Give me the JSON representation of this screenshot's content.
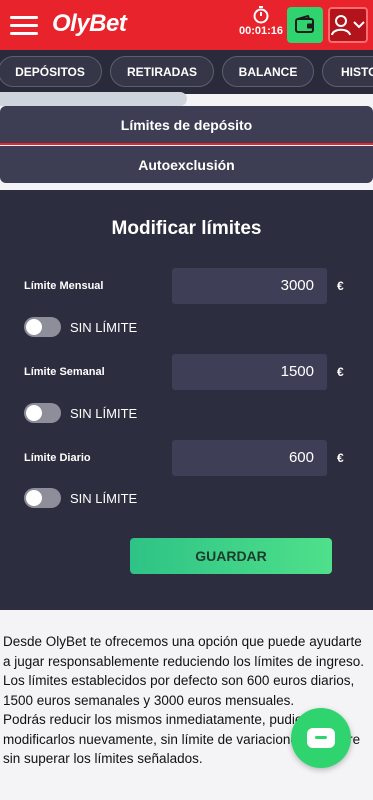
{
  "header": {
    "brand": "OlyBet",
    "session_time": "00:01:16"
  },
  "tabs": [
    {
      "label": "DEPÓSITOS"
    },
    {
      "label": "RETIRADAS"
    },
    {
      "label": "BALANCE"
    },
    {
      "label": "HISTO"
    }
  ],
  "submenu": {
    "deposit_limits": "Límites de depósito",
    "self_exclusion": "Autoexclusión"
  },
  "form": {
    "title": "Modificar límites",
    "currency": "€",
    "monthly": {
      "label": "Límite Mensual",
      "value": "3000",
      "toggle_label": "SIN LÍMITE",
      "unlimited": false
    },
    "weekly": {
      "label": "Límite Semanal",
      "value": "1500",
      "toggle_label": "SIN LÍMITE",
      "unlimited": false
    },
    "daily": {
      "label": "Límite Diario",
      "value": "600",
      "toggle_label": "SIN LÍMITE",
      "unlimited": false
    },
    "save_label": "GUARDAR"
  },
  "info": {
    "text": "Desde OlyBet te ofrecemos una opción que puede ayudarte a jugar responsablemente reduciendo los límites de ingreso.\nLos límites establecidos por defecto son 600 euros diarios, 1500 euros semanales y 3000 euros mensuales.\nPodrás reducir los mismos inmediatamente, pudiendo modificarlos nuevamente, sin límite de variaciones, siempre sin superar los límites señalados."
  },
  "colors": {
    "brand_red": "#e8232b",
    "accent_green": "#2fd46e",
    "panel_dark": "#2c2d3e"
  },
  "icons": {
    "menu": "hamburger-icon",
    "timer": "stopwatch-icon",
    "wallet": "wallet-icon",
    "user": "user-icon",
    "chat": "chat-icon"
  }
}
